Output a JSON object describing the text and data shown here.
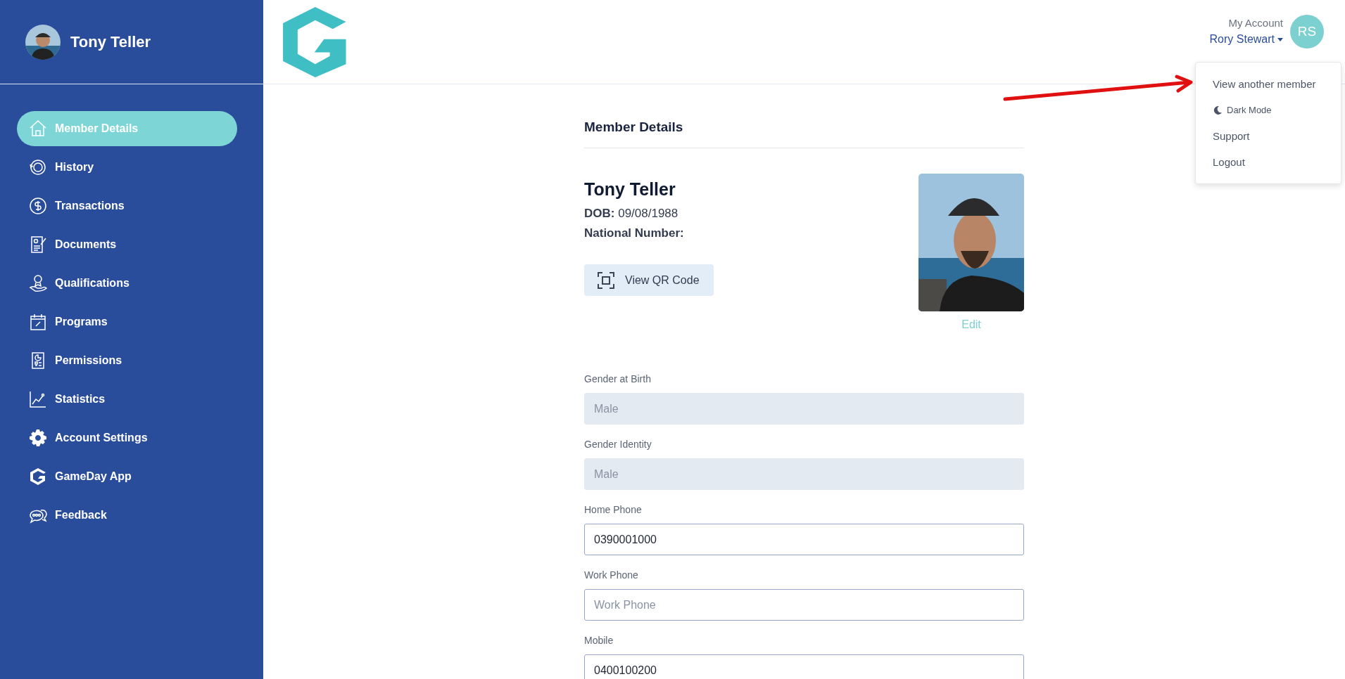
{
  "sidebar": {
    "user": {
      "name": "Tony Teller"
    },
    "items": [
      {
        "label": "Member Details",
        "selected": true
      },
      {
        "label": "History",
        "selected": false
      },
      {
        "label": "Transactions",
        "selected": false
      },
      {
        "label": "Documents",
        "selected": false
      },
      {
        "label": "Qualifications",
        "selected": false
      },
      {
        "label": "Programs",
        "selected": false
      },
      {
        "label": "Permissions",
        "selected": false
      },
      {
        "label": "Statistics",
        "selected": false
      },
      {
        "label": "Account Settings",
        "selected": false
      },
      {
        "label": "GameDay App",
        "selected": false
      },
      {
        "label": "Feedback",
        "selected": false
      }
    ]
  },
  "header": {
    "account": {
      "caption": "My Account",
      "name": "Rory Stewart",
      "initials": "RS"
    },
    "menu": [
      {
        "label": "View another member",
        "kind": "text"
      },
      {
        "label": "Dark Mode",
        "kind": "icon"
      },
      {
        "label": "Support",
        "kind": "text"
      },
      {
        "label": "Logout",
        "kind": "text"
      }
    ]
  },
  "main": {
    "title": "Member Details",
    "member": {
      "name": "Tony Teller",
      "dob_label": "DOB:",
      "dob": "09/08/1988",
      "national_number_label": "National Number:"
    },
    "qr_button": "View QR Code",
    "edit_link": "Edit",
    "fields": [
      {
        "label": "Gender at Birth",
        "value": "Male",
        "disabled": true
      },
      {
        "label": "Gender Identity",
        "value": "Male",
        "disabled": true
      },
      {
        "label": "Home Phone",
        "value": "0390001000",
        "disabled": false
      },
      {
        "label": "Work Phone",
        "placeholder": "Work Phone",
        "disabled": false
      },
      {
        "label": "Mobile",
        "value": "0400100200",
        "disabled": false
      }
    ]
  }
}
